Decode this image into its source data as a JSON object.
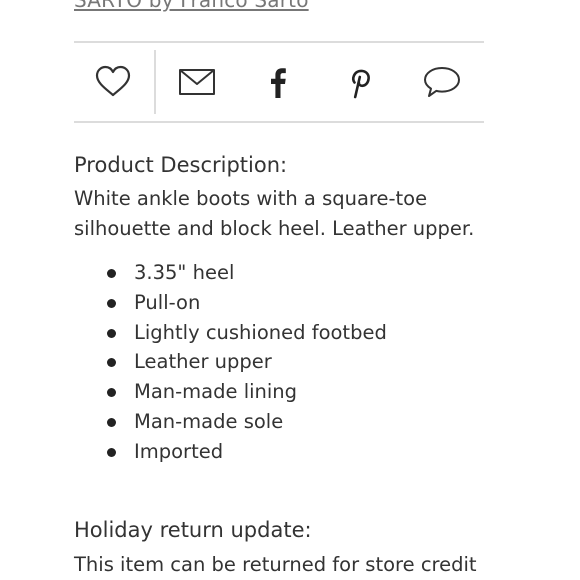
{
  "brand_link": "SARTO by Franco Sarto",
  "share": {
    "icons": [
      "heart-icon",
      "mail-icon",
      "facebook-icon",
      "pinterest-icon",
      "comment-icon"
    ]
  },
  "description": {
    "title": "Product Description:",
    "lines": [
      "White ankle boots with a square-toe",
      "silhouette and block heel. Leather upper."
    ],
    "features": [
      "3.35\" heel",
      "Pull-on",
      "Lightly cushioned footbed",
      "Leather upper",
      "Man-made lining",
      "Man-made sole",
      "Imported"
    ]
  },
  "holiday": {
    "title": "Holiday return update:",
    "text": "This item can be returned for store credit"
  },
  "colors": {
    "text": "#333333",
    "divider": "#dcdcdc",
    "link": "#777777"
  }
}
